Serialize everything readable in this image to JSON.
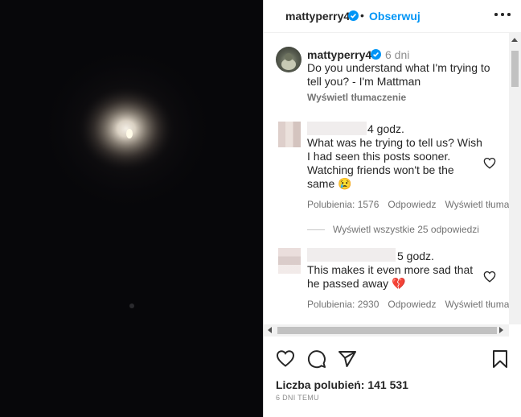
{
  "header": {
    "username": "mattyperry4",
    "separator": "•",
    "follow_label": "Obserwuj",
    "more_icon": "more-horizontal-icon",
    "verified_icon": "verified-badge-icon"
  },
  "caption": {
    "username": "mattyperry4",
    "time": "6 dni",
    "text": "Do you understand what I'm trying to tell you? - I'm Mattman",
    "translate": "Wyświetl tłumaczenie"
  },
  "comments": [
    {
      "time": "4 godz.",
      "text": "What was he trying to tell us? Wish I had seen this posts sooner. Watching friends won't be the same 😢",
      "likes": "Polubienia: 1576",
      "reply": "Odpowiedz",
      "translate": "Wyświetl tłumac",
      "replies": "Wyświetl wszystkie 25 odpowiedzi"
    },
    {
      "time": "5 godz.",
      "text": "This makes it even more sad that he passed away 💔",
      "likes": "Polubienia: 2930",
      "reply": "Odpowiedz",
      "translate": "Wyświetl tłuma"
    }
  ],
  "actions": {
    "like_icon": "heart-icon",
    "comment_icon": "comment-icon",
    "share_icon": "share-icon",
    "save_icon": "bookmark-icon"
  },
  "likes_total": "Liczba polubień: 141 531",
  "posted": "6 DNI TEMU",
  "colors": {
    "accent": "#0095f6",
    "text": "#262626",
    "muted": "#737373",
    "photo_bg": "#07070a"
  }
}
